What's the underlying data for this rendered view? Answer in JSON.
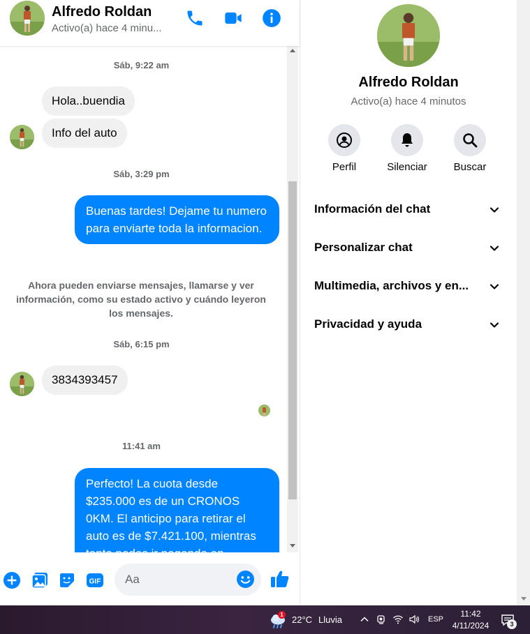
{
  "contact": {
    "name": "Alfredo Roldan",
    "status_short": "Activo(a) hace 4 minu...",
    "status_full": "Activo(a) hace 4 minutos"
  },
  "header_icons": [
    "phone-icon",
    "video-icon",
    "info-icon"
  ],
  "messages": [
    {
      "type": "timestamp",
      "text": "Sáb, 9:22 am"
    },
    {
      "type": "incoming",
      "text": "Hola..buendia"
    },
    {
      "type": "incoming",
      "text": "Info del auto"
    },
    {
      "type": "timestamp",
      "text": "Sáb, 3:29 pm"
    },
    {
      "type": "outgoing",
      "text": "Buenas tardes! Dejame tu numero para enviarte toda la informacion."
    },
    {
      "type": "system",
      "text": "Ahora pueden enviarse mensajes, llamarse y ver información, como su estado activo y cuándo leyeron los mensajes."
    },
    {
      "type": "timestamp",
      "text": "Sáb, 6:15 pm"
    },
    {
      "type": "incoming",
      "text": "3834393457"
    },
    {
      "type": "timestamp",
      "text": "11:41 am"
    },
    {
      "type": "outgoing",
      "text": "Perfecto! La cuota desde $235.000 es de un CRONOS 0KM. El anticipo para retirar el auto es de $7.421.100, mientras tanto podes ir pagando en"
    }
  ],
  "composer": {
    "placeholder": "Aa",
    "icons": [
      "plus-icon",
      "image-icon",
      "sticker-icon",
      "gif-icon",
      "emoji-icon",
      "like-icon"
    ],
    "gif_label": "GIF"
  },
  "info_panel": {
    "actions": [
      {
        "label": "Perfil",
        "icon": "profile-icon"
      },
      {
        "label": "Silenciar",
        "icon": "bell-icon"
      },
      {
        "label": "Buscar",
        "icon": "search-icon"
      }
    ],
    "sections": [
      "Información del chat",
      "Personalizar chat",
      "Multimedia, archivos y en...",
      "Privacidad y ayuda"
    ]
  },
  "taskbar": {
    "weather_temp": "22°C",
    "weather_desc": "Lluvia",
    "weather_badge": "1",
    "language": "ESP",
    "time": "11:42",
    "date": "4/11/2024",
    "notification_count": "3"
  },
  "colors": {
    "accent": "#0084ff",
    "incoming_bubble": "#f0f0f0",
    "secondary_text": "#65676b"
  }
}
